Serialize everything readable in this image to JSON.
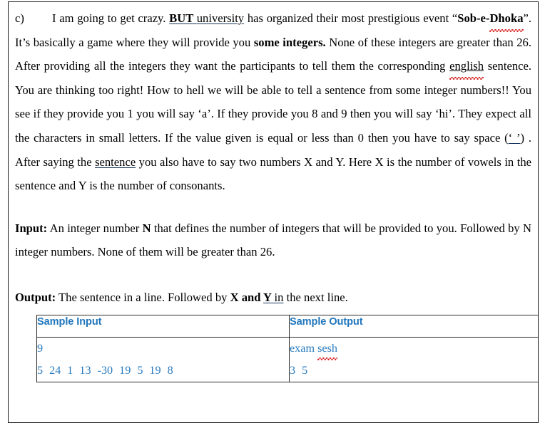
{
  "document": {
    "item_marker": "c)",
    "paragraph1": {
      "seg1": "I am going to get crazy. ",
      "seg_but": "BUT ",
      "seg_university": " university",
      "seg2": " has organized their most prestigious event “",
      "seg_sob": "Sob-e-",
      "seg_dhoka": "Dhoka",
      "seg3": "”. It’s basically a game where they will provide you ",
      "seg_some_integers": "some integers.",
      "seg4": " None of these integers are greater than 26. After providing all the integers they want the participants to tell them the corresponding ",
      "seg_english": "english",
      "seg5": " sentence. You are thinking too right! How to hell we will be able to tell a sentence from some integer numbers!! You see if they provide you 1 you will say ‘a’. If they provide you 8 and 9 then you will say ‘hi’. They expect all the characters in small letters. If the value given is equal or less than 0 then you have to say space (",
      "seg_space_quote": "‘ ’",
      "seg6": ") . After saying the ",
      "seg_sentence": "sentence",
      "seg7": " you also have to say two numbers X and Y. Here X is the number of vowels in the sentence and Y is the number of consonants."
    },
    "input_section": {
      "label": "Input:",
      "text_a": " An integer number ",
      "bold_n": "N",
      "text_b": " that defines the number of integers that will be provided to you. Followed by N integer numbers. None of them will be greater than 26."
    },
    "output_section": {
      "label": "Output:",
      "text_a": " The sentence in a line. Followed by ",
      "bold_x_and": "X and ",
      "bold_underline_y": "Y ",
      "underline_in": " in",
      "text_b": " the next line."
    },
    "sample_table": {
      "headers": [
        "Sample Input",
        "Sample Output"
      ],
      "input_line1": "9",
      "input_numbers": [
        "5",
        "24",
        "1",
        "13",
        "-30",
        "19",
        "5",
        "19",
        "8"
      ],
      "output_line1_word1": "exam",
      "output_line1_word2": "sesh",
      "output_line2": [
        "3",
        "5"
      ]
    }
  },
  "colors": {
    "header_blue": "#1f76bc",
    "body_blue": "#2b7cc0",
    "spellcheck_red": "#d82828",
    "text_black": "#000000",
    "border": "#2b2b2b"
  }
}
